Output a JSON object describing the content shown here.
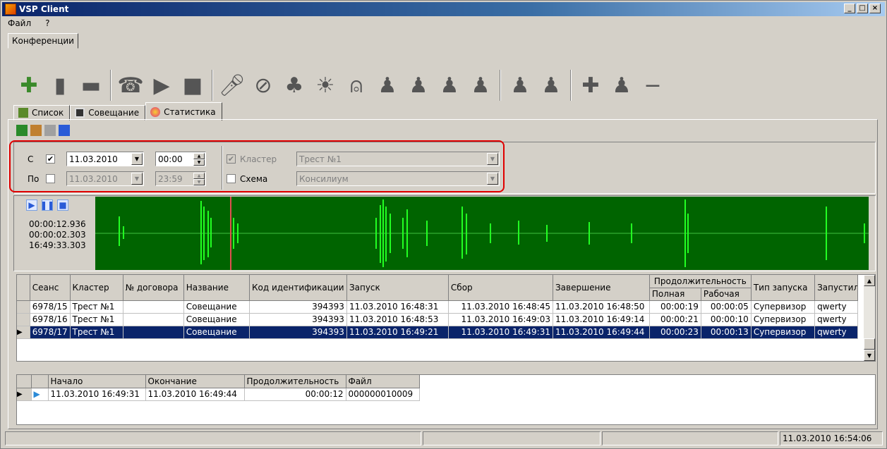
{
  "window": {
    "title": "VSP Client",
    "min": "_",
    "max": "□",
    "close": "×"
  },
  "menu": [
    "Файл",
    "?"
  ],
  "main_tab": "Конференции",
  "tabs": [
    {
      "label": "Список"
    },
    {
      "label": "Совещание"
    },
    {
      "label": "Статистика"
    }
  ],
  "filter": {
    "from_label": "С",
    "from_checked": "✔",
    "from_date": "11.03.2010",
    "from_time": "00:00",
    "to_label": "По",
    "to_date": "11.03.2010",
    "to_time": "23:59",
    "cluster_label": "Кластер",
    "cluster_value": "Трест №1",
    "cluster_checked": "✔",
    "scheme_label": "Схема",
    "scheme_value": "Консилиум"
  },
  "player": {
    "t1": "00:00:12.936",
    "t2": "00:00:02.303",
    "t3": "16:49:33.303"
  },
  "sessions": {
    "headers": [
      "Сеанс",
      "Кластер",
      "№ договора",
      "Название",
      "Код идентификации",
      "Запуск",
      "Сбор",
      "Завершение",
      "Продолжительность",
      "Полная",
      "Рабочая",
      "Тип запуска",
      "Запустил"
    ],
    "rows": [
      [
        "6978/15",
        "Трест №1",
        "",
        "Совещание",
        "394393",
        "11.03.2010 16:48:31",
        "11.03.2010 16:48:45",
        "11.03.2010 16:48:50",
        "00:00:19",
        "00:00:05",
        "Супервизор",
        "qwerty"
      ],
      [
        "6978/16",
        "Трест №1",
        "",
        "Совещание",
        "394393",
        "11.03.2010 16:48:53",
        "11.03.2010 16:49:03",
        "11.03.2010 16:49:14",
        "00:00:21",
        "00:00:10",
        "Супервизор",
        "qwerty"
      ],
      [
        "6978/17",
        "Трест №1",
        "",
        "Совещание",
        "394393",
        "11.03.2010 16:49:21",
        "11.03.2010 16:49:31",
        "11.03.2010 16:49:44",
        "00:00:23",
        "00:00:13",
        "Супервизор",
        "qwerty"
      ]
    ]
  },
  "records": {
    "headers": [
      "Начало",
      "Окончание",
      "Продолжительность",
      "Файл"
    ],
    "rows": [
      [
        "11.03.2010 16:49:31",
        "11.03.2010 16:49:44",
        "00:00:12",
        "000000010009"
      ]
    ]
  },
  "status": {
    "datetime": "11.03.2010 16:54:06"
  }
}
